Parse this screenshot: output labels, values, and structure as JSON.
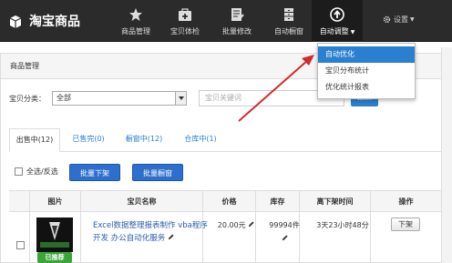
{
  "brand": {
    "title": "淘宝商品"
  },
  "nav": {
    "items": [
      {
        "label": "商品管理",
        "icon": "star-icon"
      },
      {
        "label": "宝贝体检",
        "icon": "medical-kit-icon"
      },
      {
        "label": "批量修改",
        "icon": "edit-document-icon"
      },
      {
        "label": "自动橱窗",
        "icon": "cabinet-icon"
      },
      {
        "label": "自动调整",
        "icon": "arrow-up-circle-icon",
        "active": true
      }
    ],
    "settings_label": "设置"
  },
  "dropdown": {
    "items": [
      "自动优化",
      "宝贝分布统计",
      "优化统计报表"
    ],
    "highlighted": "自动优化"
  },
  "panel": {
    "title": "商品管理"
  },
  "filter": {
    "category_label": "宝贝分类：",
    "category_value": "全部",
    "search_placeholder": "宝贝关键词",
    "search_button": "搜索"
  },
  "tabs": [
    {
      "label": "出售中(12)",
      "active": true
    },
    {
      "label": "已售完(0)"
    },
    {
      "label": "橱窗中(12)"
    },
    {
      "label": "仓库中(1)"
    }
  ],
  "actions": {
    "select_all_label": "全选/反选",
    "bulk_delist": "批量下架",
    "bulk_window": "批量橱窗"
  },
  "table": {
    "columns": [
      "图片",
      "宝贝名称",
      "价格",
      "库存",
      "离下架时间",
      "操作"
    ],
    "rows": [
      {
        "badge": "已推荐",
        "title": "Excel数据整理报表制作 vba程序开发 办公自动化服务",
        "price": "20.00元",
        "stock": "99994件",
        "time_left": "3天23小时48分",
        "action": "下架"
      }
    ]
  },
  "colors": {
    "accent": "#2a7fd1",
    "navbar": "#2b2b2b",
    "recommend_badge": "#3aa53a",
    "arrow": "#d42a2a"
  }
}
